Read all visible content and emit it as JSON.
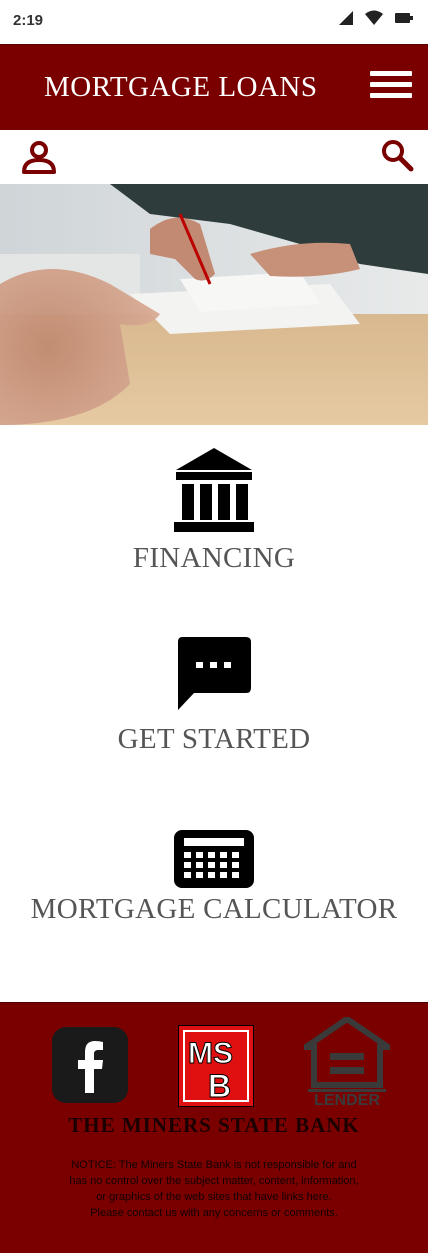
{
  "status": {
    "time": "2:19"
  },
  "header": {
    "title": "MORTGAGE LOANS"
  },
  "features": [
    {
      "label": "FINANCING",
      "icon": "bank-icon"
    },
    {
      "label": "GET STARTED",
      "icon": "chat-bubble-icon"
    },
    {
      "label": "MORTGAGE CALCULATOR",
      "icon": "calculator-icon"
    }
  ],
  "footer": {
    "bank_name": "THE MINERS STATE BANK",
    "logo_text": "MSB",
    "ehl_text": "LENDER",
    "notice_lines": [
      "NOTICE: The Miners State Bank is not responsible for and",
      "has no control over the subject matter, content, information,",
      "or graphics of the web sites that have links here.",
      "Please contact us with any concerns or comments."
    ]
  },
  "colors": {
    "brand": "#7a0000",
    "text_gray": "#555555"
  }
}
